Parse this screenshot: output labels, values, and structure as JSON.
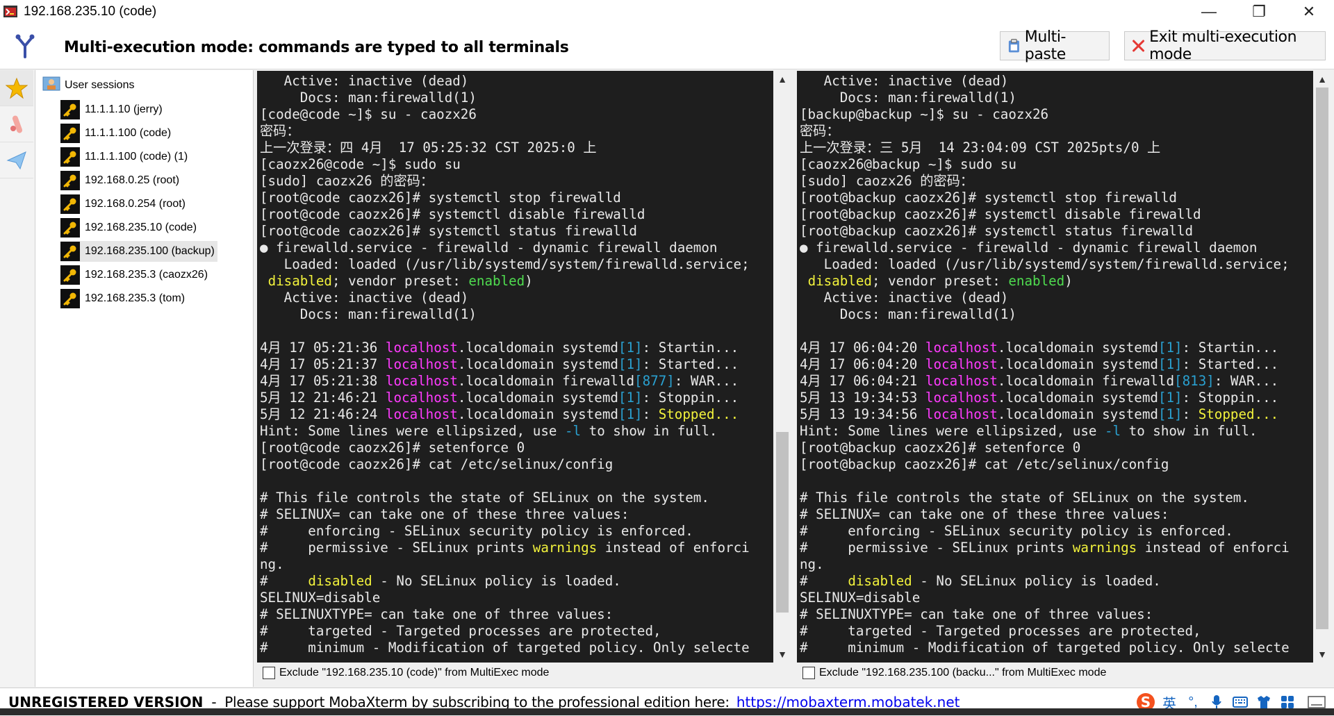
{
  "window": {
    "title": "192.168.235.10 (code)",
    "minimize": "—",
    "maximize": "❐",
    "close": "✕"
  },
  "toolbar": {
    "mode_title": "Multi-execution mode: commands are typed to all terminals",
    "multipaste_label": "Multi-paste",
    "exit_label": "Exit multi-execution mode"
  },
  "sessions": {
    "root_label": "User sessions",
    "items": [
      {
        "label": "11.1.1.10 (jerry)"
      },
      {
        "label": "11.1.1.100 (code)"
      },
      {
        "label": "11.1.1.100 (code) (1)"
      },
      {
        "label": "192.168.0.25 (root)"
      },
      {
        "label": "192.168.0.254 (root)"
      },
      {
        "label": "192.168.235.10 (code)"
      },
      {
        "label": "192.168.235.100 (backup)",
        "selected": true
      },
      {
        "label": "192.168.235.3 (caozx26)"
      },
      {
        "label": "192.168.235.3 (tom)"
      }
    ]
  },
  "terminals": [
    {
      "lines": [
        [
          [
            "   Active: inactive (dead)",
            ""
          ]
        ],
        [
          [
            "     Docs: man:firewalld(1)",
            ""
          ]
        ],
        [
          [
            "[code@code ~]$ su - caozx26",
            ""
          ]
        ],
        [
          [
            "密码：",
            ""
          ]
        ],
        [
          [
            "上一次登录：四 4月  17 05:25:32 CST 2025:0 上",
            ""
          ]
        ],
        [
          [
            "[caozx26@code ~]$ sudo su",
            ""
          ]
        ],
        [
          [
            "[sudo] caozx26 的密码：",
            ""
          ]
        ],
        [
          [
            "[root@code caozx26]# systemctl stop firewalld",
            ""
          ]
        ],
        [
          [
            "[root@code caozx26]# systemctl disable firewalld",
            ""
          ]
        ],
        [
          [
            "[root@code caozx26]# systemctl status firewalld",
            ""
          ]
        ],
        [
          [
            "● firewalld.service - firewalld - dynamic firewall daemon",
            ""
          ]
        ],
        [
          [
            "   Loaded: loaded (/usr/lib/systemd/system/firewalld.service;",
            ""
          ]
        ],
        [
          [
            " ",
            ""
          ],
          [
            "disabled",
            "yel"
          ],
          [
            "; vendor preset: ",
            ""
          ],
          [
            "enabled",
            "grn"
          ],
          [
            ")",
            ""
          ]
        ],
        [
          [
            "   Active: inactive (dead)",
            ""
          ]
        ],
        [
          [
            "     Docs: man:firewalld(1)",
            ""
          ]
        ],
        [
          [
            "",
            ""
          ]
        ],
        [
          [
            "4月 17 05:21:36 ",
            ""
          ],
          [
            "localhost",
            "mag"
          ],
          [
            ".localdomain systemd",
            ""
          ],
          [
            "[1]",
            "cyan"
          ],
          [
            ": Startin...",
            ""
          ]
        ],
        [
          [
            "4月 17 05:21:37 ",
            ""
          ],
          [
            "localhost",
            "mag"
          ],
          [
            ".localdomain systemd",
            ""
          ],
          [
            "[1]",
            "cyan"
          ],
          [
            ": Started...",
            ""
          ]
        ],
        [
          [
            "4月 17 05:21:38 ",
            ""
          ],
          [
            "localhost",
            "mag"
          ],
          [
            ".localdomain firewalld",
            ""
          ],
          [
            "[877]",
            "cyan"
          ],
          [
            ": WAR...",
            ""
          ]
        ],
        [
          [
            "5月 12 21:46:21 ",
            ""
          ],
          [
            "localhost",
            "mag"
          ],
          [
            ".localdomain systemd",
            ""
          ],
          [
            "[1]",
            "cyan"
          ],
          [
            ": Stoppin...",
            ""
          ]
        ],
        [
          [
            "5月 12 21:46:24 ",
            ""
          ],
          [
            "localhost",
            "mag"
          ],
          [
            ".localdomain systemd",
            ""
          ],
          [
            "[1]",
            "cyan"
          ],
          [
            ": ",
            ""
          ],
          [
            "Stopped...",
            "yel"
          ]
        ],
        [
          [
            "Hint: Some lines were ellipsized, use ",
            ""
          ],
          [
            "-l",
            "cyan"
          ],
          [
            " to show in full.",
            ""
          ]
        ],
        [
          [
            "[root@code caozx26]# setenforce 0",
            ""
          ]
        ],
        [
          [
            "[root@code caozx26]# cat /etc/selinux/config",
            ""
          ]
        ],
        [
          [
            "",
            ""
          ]
        ],
        [
          [
            "# This file controls the state of SELinux on the system.",
            ""
          ]
        ],
        [
          [
            "# SELINUX= can take one of these three values:",
            ""
          ]
        ],
        [
          [
            "#     enforcing - SELinux security policy is enforced.",
            ""
          ]
        ],
        [
          [
            "#     permissive - SELinux prints ",
            ""
          ],
          [
            "warnings",
            "yel"
          ],
          [
            " instead of enforci",
            ""
          ]
        ],
        [
          [
            "ng.",
            ""
          ]
        ],
        [
          [
            "#     ",
            ""
          ],
          [
            "disabled",
            "yel"
          ],
          [
            " - No SELinux policy is loaded.",
            ""
          ]
        ],
        [
          [
            "SELINUX=disable",
            ""
          ]
        ],
        [
          [
            "# SELINUXTYPE= can take one of three values:",
            ""
          ]
        ],
        [
          [
            "#     targeted - Targeted processes are protected,",
            ""
          ]
        ],
        [
          [
            "#     minimum - Modification of targeted policy. Only selecte",
            ""
          ]
        ]
      ],
      "exclude_label": "Exclude \"192.168.235.10 (code)\" from MultiExec mode"
    },
    {
      "lines": [
        [
          [
            "   Active: inactive (dead)",
            ""
          ]
        ],
        [
          [
            "     Docs: man:firewalld(1)",
            ""
          ]
        ],
        [
          [
            "[backup@backup ~]$ su - caozx26",
            ""
          ]
        ],
        [
          [
            "密码：",
            ""
          ]
        ],
        [
          [
            "上一次登录：三 5月  14 23:04:09 CST 2025pts/0 上",
            ""
          ]
        ],
        [
          [
            "[caozx26@backup ~]$ sudo su",
            ""
          ]
        ],
        [
          [
            "[sudo] caozx26 的密码：",
            ""
          ]
        ],
        [
          [
            "[root@backup caozx26]# systemctl stop firewalld",
            ""
          ]
        ],
        [
          [
            "[root@backup caozx26]# systemctl disable firewalld",
            ""
          ]
        ],
        [
          [
            "[root@backup caozx26]# systemctl status firewalld",
            ""
          ]
        ],
        [
          [
            "● firewalld.service - firewalld - dynamic firewall daemon",
            ""
          ]
        ],
        [
          [
            "   Loaded: loaded (/usr/lib/systemd/system/firewalld.service;",
            ""
          ]
        ],
        [
          [
            " ",
            ""
          ],
          [
            "disabled",
            "yel"
          ],
          [
            "; vendor preset: ",
            ""
          ],
          [
            "enabled",
            "grn"
          ],
          [
            ")",
            ""
          ]
        ],
        [
          [
            "   Active: inactive (dead)",
            ""
          ]
        ],
        [
          [
            "     Docs: man:firewalld(1)",
            ""
          ]
        ],
        [
          [
            "",
            ""
          ]
        ],
        [
          [
            "4月 17 06:04:20 ",
            ""
          ],
          [
            "localhost",
            "mag"
          ],
          [
            ".localdomain systemd",
            ""
          ],
          [
            "[1]",
            "cyan"
          ],
          [
            ": Startin...",
            ""
          ]
        ],
        [
          [
            "4月 17 06:04:20 ",
            ""
          ],
          [
            "localhost",
            "mag"
          ],
          [
            ".localdomain systemd",
            ""
          ],
          [
            "[1]",
            "cyan"
          ],
          [
            ": Started...",
            ""
          ]
        ],
        [
          [
            "4月 17 06:04:21 ",
            ""
          ],
          [
            "localhost",
            "mag"
          ],
          [
            ".localdomain firewalld",
            ""
          ],
          [
            "[813]",
            "cyan"
          ],
          [
            ": WAR...",
            ""
          ]
        ],
        [
          [
            "5月 13 19:34:53 ",
            ""
          ],
          [
            "localhost",
            "mag"
          ],
          [
            ".localdomain systemd",
            ""
          ],
          [
            "[1]",
            "cyan"
          ],
          [
            ": Stoppin...",
            ""
          ]
        ],
        [
          [
            "5月 13 19:34:56 ",
            ""
          ],
          [
            "localhost",
            "mag"
          ],
          [
            ".localdomain systemd",
            ""
          ],
          [
            "[1]",
            "cyan"
          ],
          [
            ": ",
            ""
          ],
          [
            "Stopped...",
            "yel"
          ]
        ],
        [
          [
            "Hint: Some lines were ellipsized, use ",
            ""
          ],
          [
            "-l",
            "cyan"
          ],
          [
            " to show in full.",
            ""
          ]
        ],
        [
          [
            "[root@backup caozx26]# setenforce 0",
            ""
          ]
        ],
        [
          [
            "[root@backup caozx26]# cat /etc/selinux/config",
            ""
          ]
        ],
        [
          [
            "",
            ""
          ]
        ],
        [
          [
            "# This file controls the state of SELinux on the system.",
            ""
          ]
        ],
        [
          [
            "# SELINUX= can take one of these three values:",
            ""
          ]
        ],
        [
          [
            "#     enforcing - SELinux security policy is enforced.",
            ""
          ]
        ],
        [
          [
            "#     permissive - SELinux prints ",
            ""
          ],
          [
            "warnings",
            "yel"
          ],
          [
            " instead of enforci",
            ""
          ]
        ],
        [
          [
            "ng.",
            ""
          ]
        ],
        [
          [
            "#     ",
            ""
          ],
          [
            "disabled",
            "yel"
          ],
          [
            " - No SELinux policy is loaded.",
            ""
          ]
        ],
        [
          [
            "SELINUX=disable",
            ""
          ]
        ],
        [
          [
            "# SELINUXTYPE= can take one of three values:",
            ""
          ]
        ],
        [
          [
            "#     targeted - Targeted processes are protected,",
            ""
          ]
        ],
        [
          [
            "#     minimum - Modification of targeted policy. Only selecte",
            ""
          ]
        ]
      ],
      "exclude_label": "Exclude \"192.168.235.100 (backu...\" from MultiExec mode"
    }
  ],
  "statusbar": {
    "unregistered": "UNREGISTERED VERSION",
    "separator": "-",
    "support_text": "Please support MobaXterm by subscribing to the professional edition here:",
    "link": "https://mobaxterm.mobatek.net",
    "ime_label": "英"
  },
  "colors": {
    "terminal_bg": "#1e1e1e",
    "magenta": "#ff3bff",
    "cyan": "#2aa1d1",
    "yellow": "#f3f33c",
    "green": "#4fdc4f"
  }
}
